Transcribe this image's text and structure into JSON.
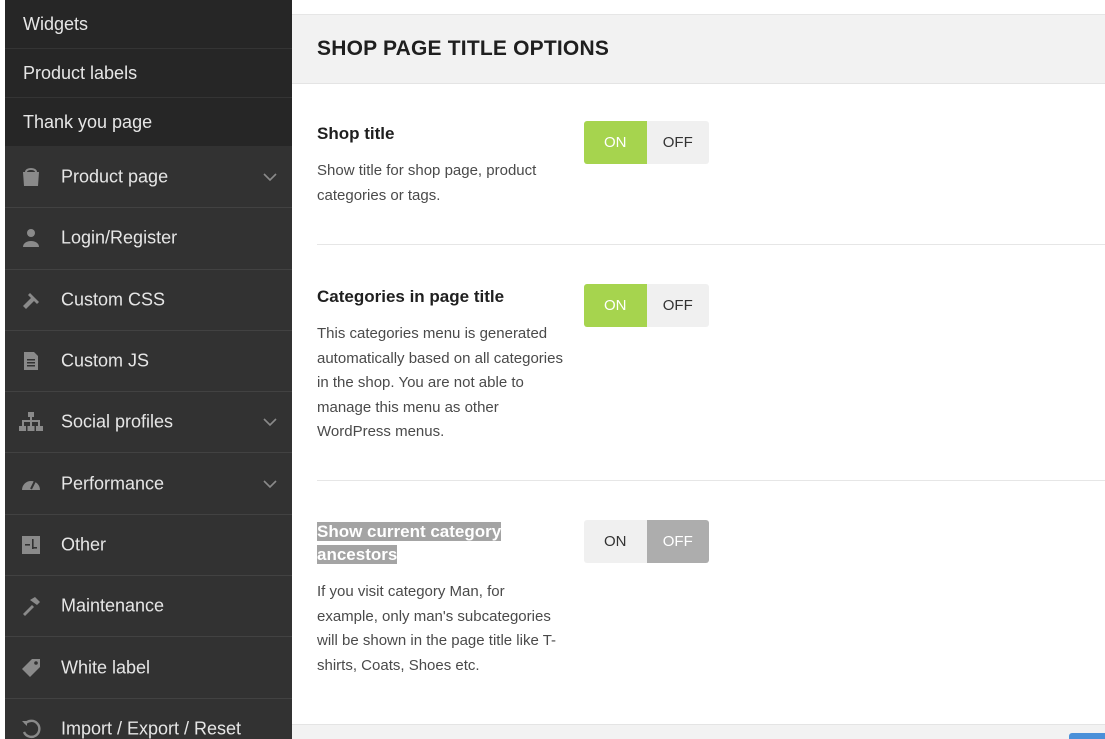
{
  "sidebar": {
    "sub_items": [
      {
        "label": "Widgets"
      },
      {
        "label": "Product labels"
      },
      {
        "label": "Thank you page"
      }
    ],
    "menu_items": [
      {
        "label": "Product page",
        "icon": "shop-icon",
        "has_children": true
      },
      {
        "label": "Login/Register",
        "icon": "user-icon",
        "has_children": false
      },
      {
        "label": "Custom CSS",
        "icon": "css-icon",
        "has_children": false
      },
      {
        "label": "Custom JS",
        "icon": "file-icon",
        "has_children": false
      },
      {
        "label": "Social profiles",
        "icon": "sitemap-icon",
        "has_children": true
      },
      {
        "label": "Performance",
        "icon": "dashboard-icon",
        "has_children": true
      },
      {
        "label": "Other",
        "icon": "other-icon",
        "has_children": false
      },
      {
        "label": "Maintenance",
        "icon": "hammer-icon",
        "has_children": false
      },
      {
        "label": "White label",
        "icon": "tag-icon",
        "has_children": false
      },
      {
        "label": "Import / Export / Reset",
        "icon": "reset-icon",
        "has_children": false
      }
    ]
  },
  "main": {
    "section_title": "SHOP PAGE TITLE OPTIONS",
    "options": [
      {
        "title": "Shop title",
        "description": "Show title for shop page, product categories or tags.",
        "value": "ON"
      },
      {
        "title": "Categories in page title",
        "description": "This categories menu is generated automatically based on all categories in the shop. You are not able to manage this menu as other WordPress menus.",
        "value": "ON"
      },
      {
        "title": "Show current category ancestors",
        "description": "If you visit category Man, for example, only man's subcategories will be shown in the page title like T-shirts, Coats, Shoes etc.",
        "value": "OFF"
      }
    ],
    "toggle_labels": {
      "on": "ON",
      "off": "OFF"
    }
  },
  "colors": {
    "sidebar_bg": "#323232",
    "sidebar_sub_bg": "#262626",
    "toggle_on": "#a6d44e",
    "toggle_off_active": "#adadad"
  }
}
